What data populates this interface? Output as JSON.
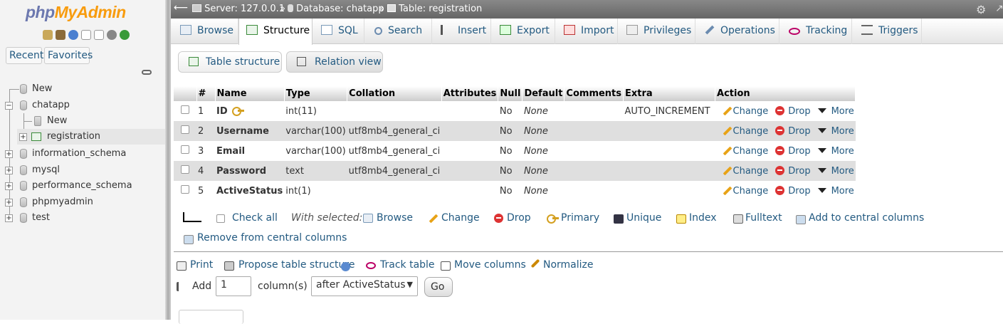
{
  "nav": {
    "logo_php": "php",
    "logo_admin": "MyAdmin",
    "tabs": [
      "Recent",
      "Favorites"
    ],
    "tree": [
      {
        "label": "New"
      },
      {
        "label": "chatapp",
        "children": [
          {
            "label": "New"
          },
          {
            "label": "registration"
          }
        ]
      },
      {
        "label": "information_schema"
      },
      {
        "label": "mysql"
      },
      {
        "label": "performance_schema"
      },
      {
        "label": "phpmyadmin"
      },
      {
        "label": "test"
      }
    ]
  },
  "breadcrumb": {
    "server": "Server: 127.0.0.1",
    "database": "Database: chatapp",
    "table": "Table: registration",
    "sep": "»"
  },
  "tabs": [
    "Browse",
    "Structure",
    "SQL",
    "Search",
    "Insert",
    "Export",
    "Import",
    "Privileges",
    "Operations",
    "Tracking",
    "Triggers"
  ],
  "active_tab": "Structure",
  "subtabs": [
    "Table structure",
    "Relation view"
  ],
  "table": {
    "headers": [
      "#",
      "Name",
      "Type",
      "Collation",
      "Attributes",
      "Null",
      "Default",
      "Comments",
      "Extra",
      "Action"
    ],
    "rows": [
      {
        "num": "1",
        "name": "ID",
        "type": "int(11)",
        "collation": "",
        "attributes": "",
        "null": "No",
        "default": "None",
        "comments": "",
        "extra": "AUTO_INCREMENT"
      },
      {
        "num": "2",
        "name": "Username",
        "type": "varchar(100)",
        "collation": "utf8mb4_general_ci",
        "attributes": "",
        "null": "No",
        "default": "None",
        "comments": "",
        "extra": ""
      },
      {
        "num": "3",
        "name": "Email",
        "type": "varchar(100)",
        "collation": "utf8mb4_general_ci",
        "attributes": "",
        "null": "No",
        "default": "None",
        "comments": "",
        "extra": ""
      },
      {
        "num": "4",
        "name": "Password",
        "type": "text",
        "collation": "utf8mb4_general_ci",
        "attributes": "",
        "null": "No",
        "default": "None",
        "comments": "",
        "extra": ""
      },
      {
        "num": "5",
        "name": "ActiveStatus",
        "type": "int(1)",
        "collation": "",
        "attributes": "",
        "null": "No",
        "default": "None",
        "comments": "",
        "extra": ""
      }
    ],
    "actions": {
      "change": "Change",
      "drop": "Drop",
      "more": "More"
    }
  },
  "bulk": {
    "check_all": "Check all",
    "with_selected": "With selected:",
    "actions": [
      "Browse",
      "Change",
      "Drop",
      "Primary",
      "Unique",
      "Index",
      "Fulltext",
      "Add to central columns",
      "Remove from central columns"
    ]
  },
  "bottom": {
    "links": [
      "Print",
      "Propose table structure",
      "Track table",
      "Move columns",
      "Normalize"
    ],
    "add_label": "Add",
    "add_count": "1",
    "columns_label": "column(s)",
    "position": "after ActiveStatus",
    "go": "Go"
  },
  "colors": {
    "link": "#235a81",
    "header": "#666666",
    "row_alt": "#dfdfdf"
  }
}
